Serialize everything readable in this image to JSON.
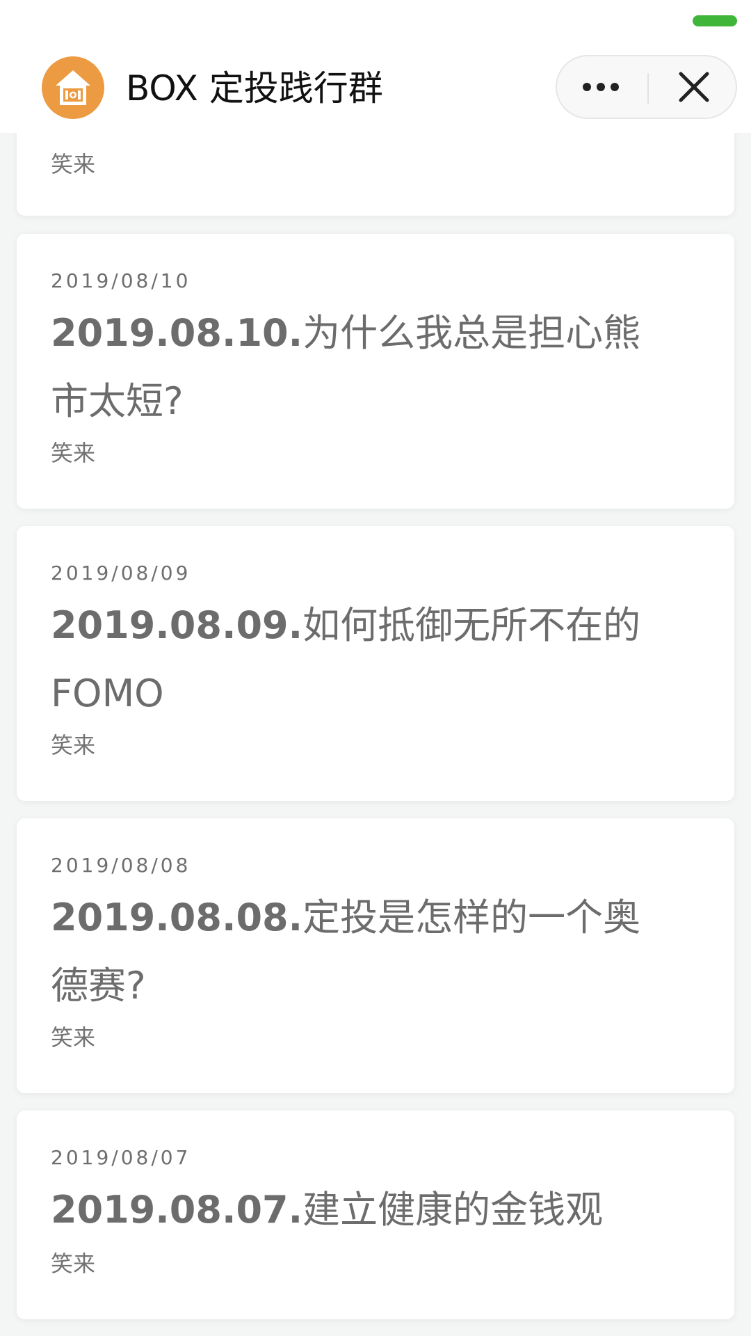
{
  "app": {
    "title": "BOX 定投践行群",
    "logo_icon": "home-dollar-icon",
    "accent_color": "#ec9b43",
    "status_indicator_color": "#3fb53a"
  },
  "capsule": {
    "more_icon": "more-dots-icon",
    "close_icon": "close-icon"
  },
  "partial_card": {
    "author": "笑来"
  },
  "articles": [
    {
      "date": "2019/08/10",
      "title_number": "2019.08.10.",
      "title_text": "为什么我总是担心熊市太短?",
      "author": "笑来"
    },
    {
      "date": "2019/08/09",
      "title_number": "2019.08.09.",
      "title_text": "如何抵御无所不在的FOMO",
      "author": "笑来"
    },
    {
      "date": "2019/08/08",
      "title_number": "2019.08.08.",
      "title_text": "定投是怎样的一个奥德赛?",
      "author": "笑来"
    },
    {
      "date": "2019/08/07",
      "title_number": "2019.08.07.",
      "title_text": "建立健康的金钱观",
      "author": "笑来"
    }
  ]
}
